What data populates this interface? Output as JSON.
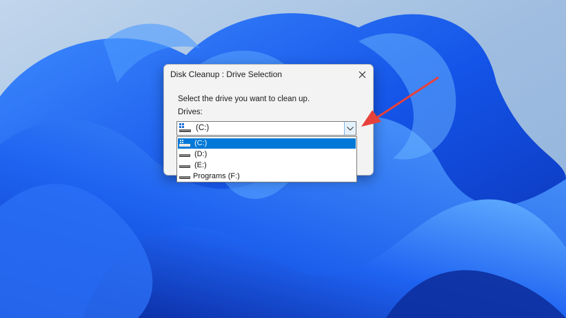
{
  "dialog": {
    "title": "Disk Cleanup : Drive Selection",
    "prompt": "Select the drive you want to clean up.",
    "drives_label": "Drives:",
    "selected_drive": "(C:)"
  },
  "dropdown": {
    "items": [
      {
        "label": "(C:)",
        "selected": true
      },
      {
        "label": "(D:)",
        "selected": false
      },
      {
        "label": "(E:)",
        "selected": false
      },
      {
        "label": "Programs (F:)",
        "selected": false
      }
    ]
  },
  "icons": {
    "close": "close-icon",
    "combo_arrow": "chevron-down-icon",
    "system_drive": "windows-drive-icon",
    "drive": "hard-drive-icon",
    "annotation": "red-arrow"
  },
  "colors": {
    "selection": "#0078d7",
    "annotation_arrow": "#e8413a",
    "wallpaper_blue": "#1f57e0"
  }
}
